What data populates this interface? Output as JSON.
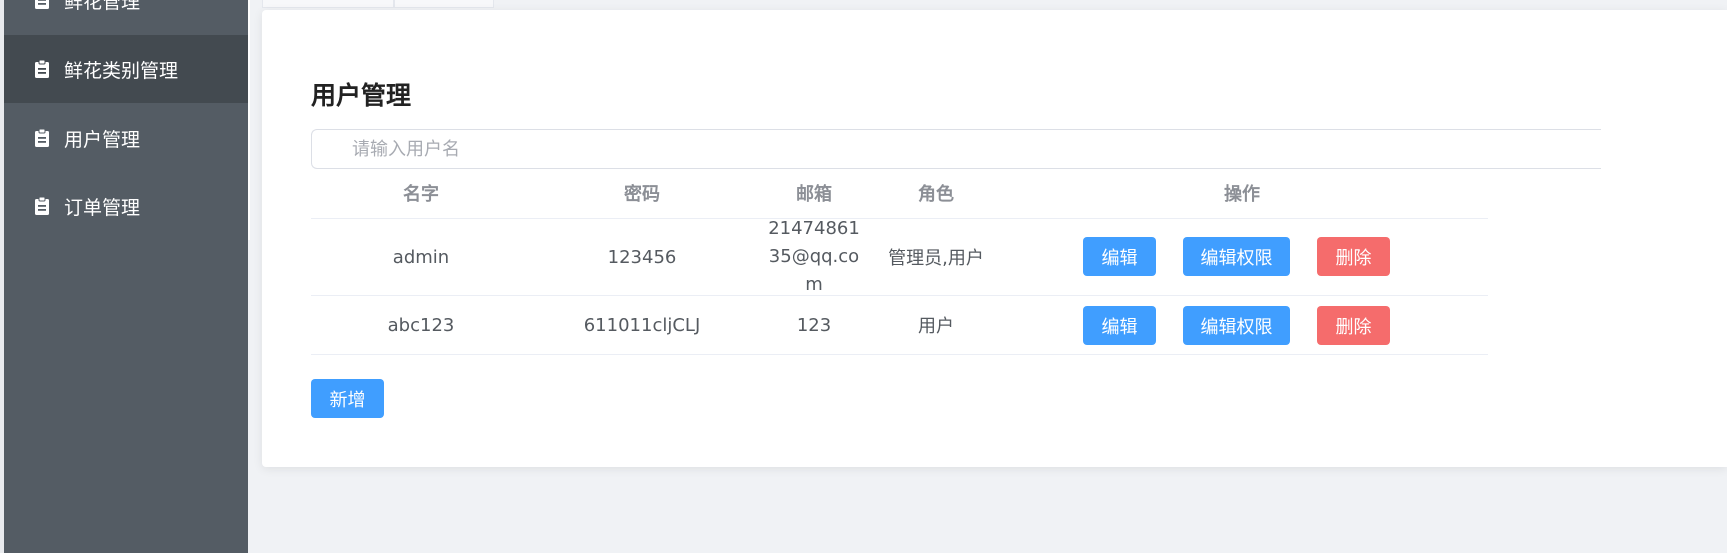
{
  "sidebar": {
    "items": [
      {
        "label": "鲜花管理",
        "icon": "clipboard-icon",
        "active": false
      },
      {
        "label": "鲜花类别管理",
        "icon": "clipboard-icon",
        "active": true
      },
      {
        "label": "用户管理",
        "icon": "clipboard-icon",
        "active": false
      },
      {
        "label": "订单管理",
        "icon": "clipboard-icon",
        "active": false
      }
    ]
  },
  "main": {
    "title": "用户管理",
    "search": {
      "placeholder": "请输入用户名",
      "value": ""
    },
    "table": {
      "columns": [
        "名字",
        "密码",
        "邮箱",
        "角色",
        "操作"
      ],
      "rows": [
        {
          "name": "admin",
          "password": "123456",
          "email": "2147486135@qq.com",
          "role": "管理员,用户"
        },
        {
          "name": "abc123",
          "password": "611011cljCLJ",
          "email": "123",
          "role": "用户"
        }
      ],
      "actions": {
        "edit": "编辑",
        "edit_permissions": "编辑权限",
        "delete": "删除"
      }
    },
    "add_button": "新增"
  },
  "colors": {
    "sidebar_bg": "#545c64",
    "sidebar_active_bg": "#434a50",
    "primary": "#409eff",
    "danger": "#f56c6c"
  }
}
